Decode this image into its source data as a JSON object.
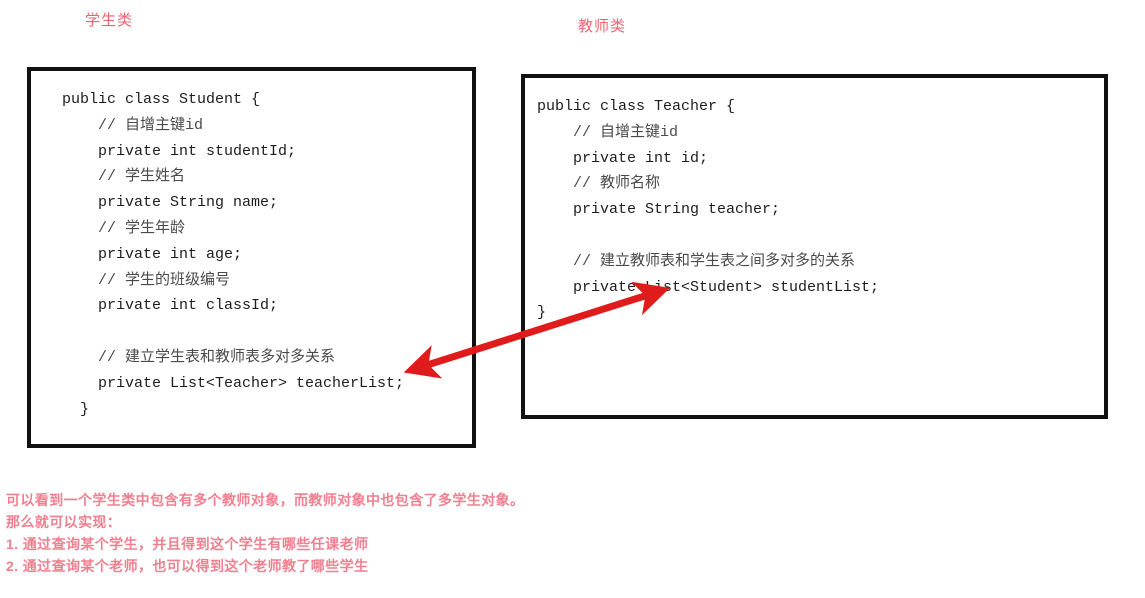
{
  "captions": {
    "student": "学生类",
    "teacher": "教师类"
  },
  "colors": {
    "caption": "#ee6570",
    "note": "#f08090",
    "arrow": "#e01b1b",
    "box_border": "#111111",
    "code_text": "#1d1d1d",
    "code_comment": "#4a4a4a"
  },
  "student_code": {
    "lines": [
      {
        "text": "public class Student {",
        "comment": false
      },
      {
        "text": "    // 自增主键id",
        "comment": true
      },
      {
        "text": "    private int studentId;",
        "comment": false
      },
      {
        "text": "    // 学生姓名",
        "comment": true
      },
      {
        "text": "    private String name;",
        "comment": false
      },
      {
        "text": "    // 学生年龄",
        "comment": true
      },
      {
        "text": "    private int age;",
        "comment": false
      },
      {
        "text": "    // 学生的班级编号",
        "comment": true
      },
      {
        "text": "    private int classId;",
        "comment": false
      },
      {
        "text": "",
        "comment": false
      },
      {
        "text": "    // 建立学生表和教师表多对多关系",
        "comment": true
      },
      {
        "text": "    private List<Teacher> teacherList;",
        "comment": false
      },
      {
        "text": "  }",
        "comment": false
      }
    ]
  },
  "teacher_code": {
    "lines": [
      {
        "text": "public class Teacher {",
        "comment": false
      },
      {
        "text": "    // 自增主键id",
        "comment": true
      },
      {
        "text": "    private int id;",
        "comment": false
      },
      {
        "text": "    // 教师名称",
        "comment": true
      },
      {
        "text": "    private String teacher;",
        "comment": false
      },
      {
        "text": "",
        "comment": false
      },
      {
        "text": "    // 建立教师表和学生表之间多对多的关系",
        "comment": true
      },
      {
        "text": "    private List<Student> studentList;",
        "comment": false
      },
      {
        "text": "}",
        "comment": false
      }
    ]
  },
  "arrow": {
    "name": "many-to-many-relation-arrow",
    "double_headed": true
  },
  "bottom_note": {
    "lines": [
      "可以看到一个学生类中包含有多个教师对象，而教师对象中也包含了多学生对象。",
      "那么就可以实现：",
      "1. 通过查询某个学生，并且得到这个学生有哪些任课老师",
      "2. 通过查询某个老师，也可以得到这个老师教了哪些学生"
    ]
  }
}
